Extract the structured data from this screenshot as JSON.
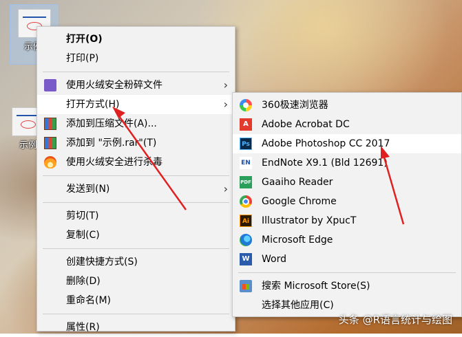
{
  "desktop": {
    "icons": [
      {
        "label": "示例."
      },
      {
        "label": "示例"
      }
    ]
  },
  "context_menu": {
    "items": [
      {
        "label": "打开(O)"
      },
      {
        "label": "打印(P)"
      },
      {
        "label": "使用火绒安全粉碎文件"
      },
      {
        "label": "打开方式(H)"
      },
      {
        "label": "添加到压缩文件(A)..."
      },
      {
        "label": "添加到 \"示例.rar\"(T)"
      },
      {
        "label": "使用火绒安全进行杀毒"
      },
      {
        "label": "发送到(N)"
      },
      {
        "label": "剪切(T)"
      },
      {
        "label": "复制(C)"
      },
      {
        "label": "创建快捷方式(S)"
      },
      {
        "label": "删除(D)"
      },
      {
        "label": "重命名(M)"
      },
      {
        "label": "属性(R)"
      }
    ]
  },
  "open_with_menu": {
    "items": [
      {
        "label": "360极速浏览器"
      },
      {
        "label": "Adobe Acrobat DC"
      },
      {
        "label": "Adobe Photoshop CC 2017"
      },
      {
        "label": "EndNote X9.1 (Bld 12691)"
      },
      {
        "label": "Gaaiho Reader"
      },
      {
        "label": "Google Chrome"
      },
      {
        "label": "Illustrator by XpucT"
      },
      {
        "label": "Microsoft Edge"
      },
      {
        "label": "Word"
      },
      {
        "label": "搜索 Microsoft Store(S)"
      },
      {
        "label": "选择其他应用(C)"
      }
    ]
  },
  "icons": {
    "chevron": "›",
    "acrobat": "A",
    "photoshop": "Ps",
    "endnote": "EN",
    "gaaiho": "PDF",
    "illustrator": "Ai",
    "word": "W"
  },
  "watermark": "头条 @R语言统计与绘图",
  "colors": {
    "menu_bg": "#f2f2f2",
    "hover_bg": "#ffffff",
    "arrow": "#e02020"
  }
}
